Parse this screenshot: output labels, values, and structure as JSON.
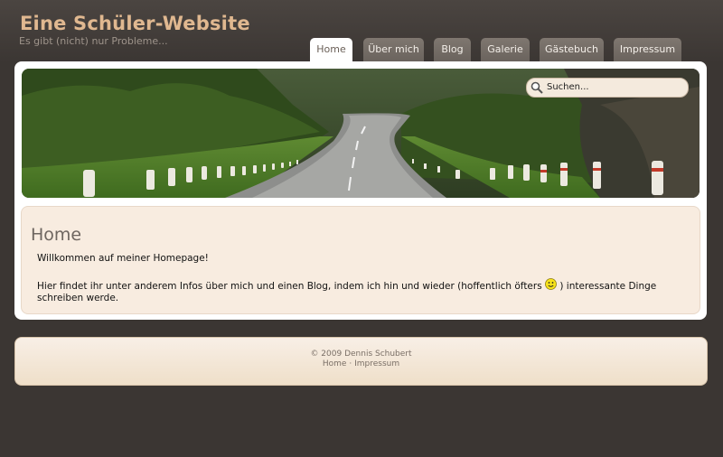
{
  "site": {
    "title": "Eine Schüler-Website",
    "tagline": "Es gibt (nicht) nur Probleme..."
  },
  "nav": {
    "tabs": [
      {
        "label": "Home",
        "active": true
      },
      {
        "label": "Über mich",
        "active": false
      },
      {
        "label": "Blog",
        "active": false
      },
      {
        "label": "Galerie",
        "active": false
      },
      {
        "label": "Gästebuch",
        "active": false
      },
      {
        "label": "Impressum",
        "active": false
      }
    ]
  },
  "search": {
    "placeholder": "Suchen...",
    "icon": "magnifier-icon"
  },
  "content": {
    "heading": "Home",
    "welcome": "Willkommen auf meiner Homepage!",
    "intro_before": "Hier findet ihr unter anderem Infos über mich und einen Blog, indem ich hin und wieder (hoffentlich öfters ",
    "intro_after": " ) interessante Dinge schreiben werde.",
    "emoticon": "smiley-icon"
  },
  "footer": {
    "copyright": "© 2009 Dennis Schubert",
    "links": [
      "Home",
      "Impressum"
    ],
    "separator": "·"
  },
  "colors": {
    "background": "#3b3633",
    "title": "#e0b890",
    "tab": "#746c66",
    "content": "#f8ece0"
  }
}
